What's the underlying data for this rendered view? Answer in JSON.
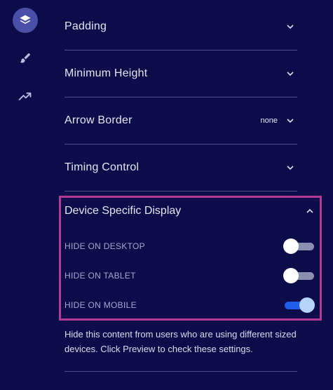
{
  "sidebar": {
    "items": [
      {
        "icon": "layers-icon",
        "active": true
      },
      {
        "icon": "brush-icon",
        "active": false
      },
      {
        "icon": "trending-icon",
        "active": false
      }
    ]
  },
  "sections": [
    {
      "title": "Padding",
      "value": ""
    },
    {
      "title": "Minimum Height",
      "value": ""
    },
    {
      "title": "Arrow Border",
      "value": "none"
    },
    {
      "title": "Timing Control",
      "value": ""
    }
  ],
  "device_display": {
    "title": "Device Specific Display",
    "toggles": [
      {
        "label": "HIDE ON DESKTOP",
        "on": false
      },
      {
        "label": "HIDE ON TABLET",
        "on": false
      },
      {
        "label": "HIDE ON MOBILE",
        "on": true
      }
    ],
    "description": "Hide this content from users who are using different sized devices. Click Preview to check these settings."
  },
  "colors": {
    "background": "#0c0c4a",
    "highlight_border": "#b13c93",
    "toggle_on": "#1e5ee8"
  }
}
